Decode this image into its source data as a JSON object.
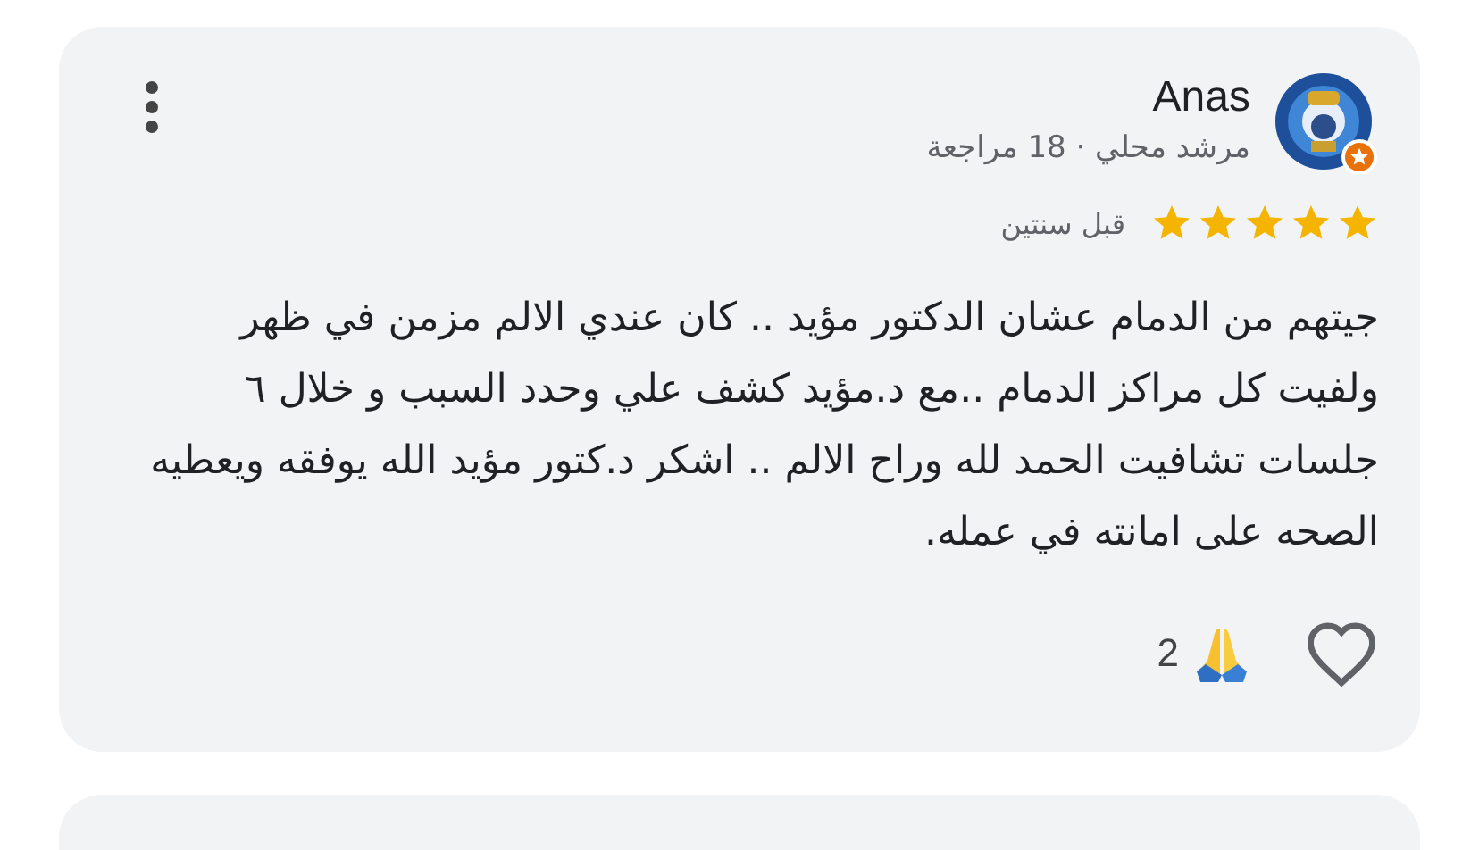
{
  "review": {
    "author": "Anas",
    "subtitle": "مرشد محلي · 18 مراجعة",
    "stars": 5,
    "time": "قبل سنتين",
    "text": "جيتهم من الدمام عشان الدكتور مؤيد .. كان عندي الالم مزمن في ظهر ولفيت كل مراكز الدمام ..مع د.مؤيد كشف علي وحدد السبب و خلال ٦ جلسات تشافيت الحمد لله وراح الالم .. اشكر د.كتور مؤيد الله يوفقه ويعطيه الصحه على امانته في عمله.",
    "reaction_count": "2",
    "liked": false
  }
}
